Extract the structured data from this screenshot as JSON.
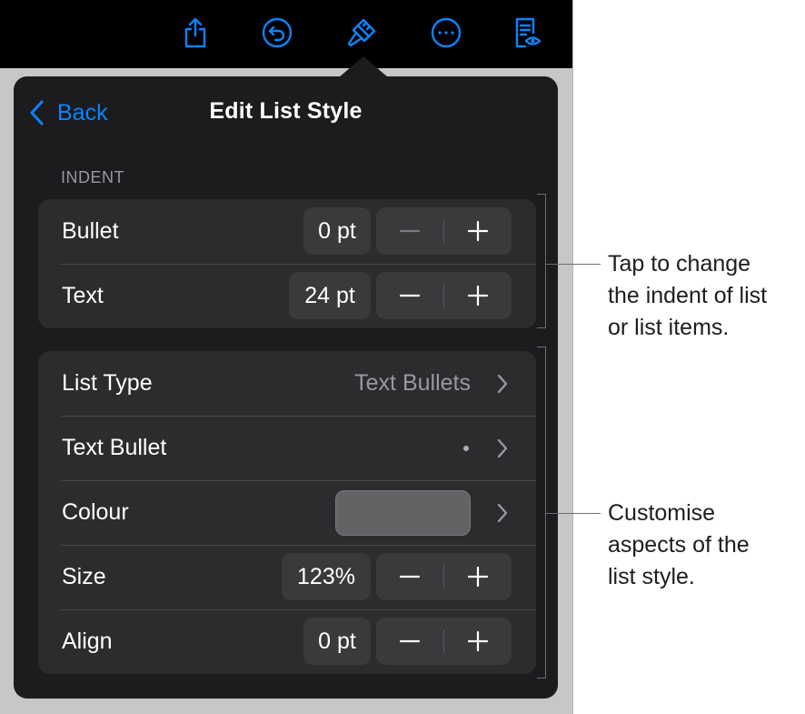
{
  "colors": {
    "accent": "#0a84ff",
    "popover_bg": "#1c1c1e",
    "group_bg": "#2c2c2e",
    "control_bg": "#3a3a3c",
    "secondary_text": "#98989f",
    "colour_swatch": "#636366"
  },
  "toolbar": {
    "icons": [
      "share-icon",
      "undo-icon",
      "format-brush-icon",
      "more-icon",
      "reading-view-icon"
    ]
  },
  "popover": {
    "back_label": "Back",
    "title": "Edit List Style",
    "indent_section_label": "INDENT",
    "indent_rows": {
      "bullet": {
        "label": "Bullet",
        "value": "0 pt"
      },
      "text": {
        "label": "Text",
        "value": "24 pt"
      }
    },
    "style_rows": {
      "list_type": {
        "label": "List Type",
        "value": "Text Bullets"
      },
      "text_bullet": {
        "label": "Text Bullet",
        "value": "•"
      },
      "colour": {
        "label": "Colour"
      },
      "size": {
        "label": "Size",
        "value": "123%"
      },
      "align": {
        "label": "Align",
        "value": "0 pt"
      }
    }
  },
  "callouts": {
    "indent": [
      "Tap to change",
      "the indent of list",
      "or list items."
    ],
    "style": [
      "Customise",
      "aspects of the",
      "list style."
    ]
  }
}
